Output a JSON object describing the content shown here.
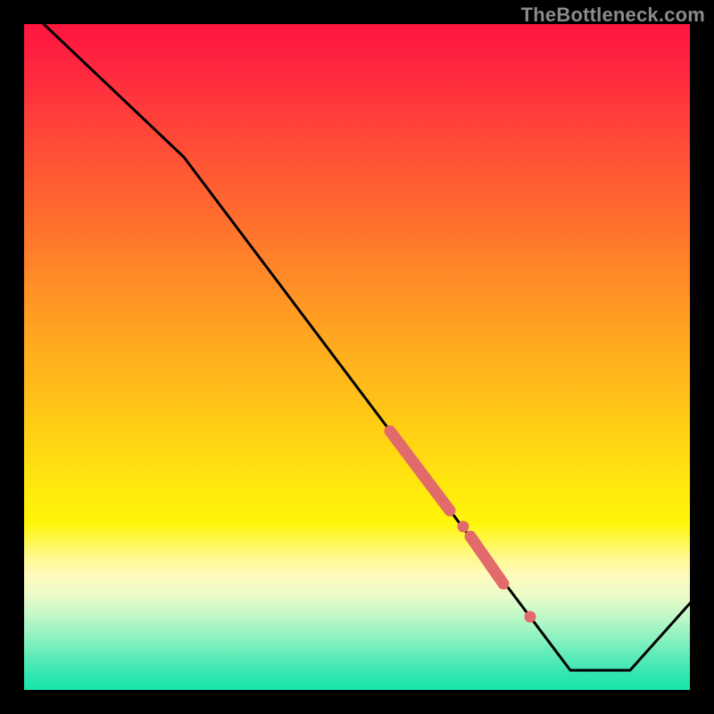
{
  "watermark": "TheBottleneck.com",
  "chart_data": {
    "type": "line",
    "title": "",
    "xlabel": "",
    "ylabel": "",
    "xlim": [
      0,
      100
    ],
    "ylim": [
      0,
      100
    ],
    "grid": false,
    "series": [
      {
        "name": "curve",
        "color": "#000000",
        "x": [
          3,
          24,
          82,
          91,
          100
        ],
        "y": [
          100,
          80,
          3,
          3,
          13
        ]
      },
      {
        "name": "highlight-segment-1",
        "color": "#e36a6a",
        "style": "thick",
        "x": [
          55,
          64
        ],
        "y": [
          39,
          27
        ]
      },
      {
        "name": "highlight-segment-2",
        "color": "#e36a6a",
        "style": "thick",
        "x": [
          67,
          72
        ],
        "y": [
          23,
          16
        ]
      },
      {
        "name": "highlight-dot-1",
        "color": "#e36a6a",
        "style": "dot",
        "x": [
          66
        ],
        "y": [
          24.5
        ]
      },
      {
        "name": "highlight-dot-2",
        "color": "#e36a6a",
        "style": "dot",
        "x": [
          76
        ],
        "y": [
          11
        ]
      }
    ],
    "background_gradient": {
      "top": "#ff153f",
      "bottom": "#1ae4ac",
      "stops": [
        "red",
        "orange",
        "yellow",
        "pale-yellow",
        "green"
      ]
    }
  }
}
